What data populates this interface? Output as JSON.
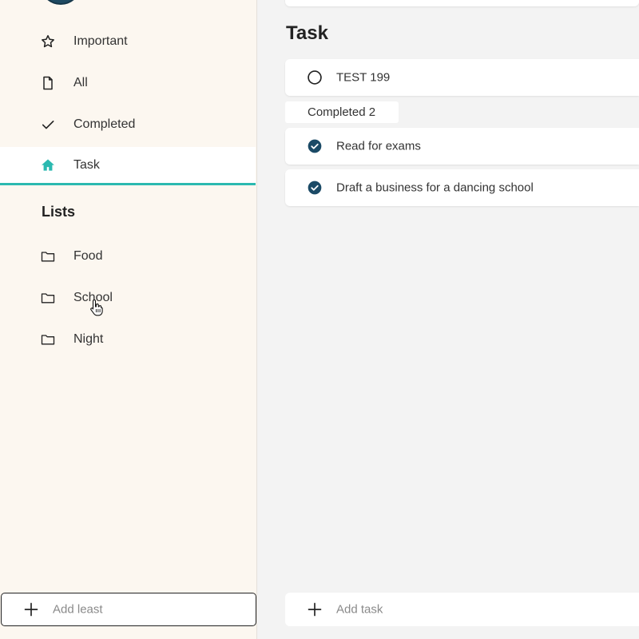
{
  "sidebar": {
    "nav": [
      {
        "label": "Important",
        "icon": "star-icon"
      },
      {
        "label": "All",
        "icon": "file-icon"
      },
      {
        "label": "Completed",
        "icon": "check-icon"
      },
      {
        "label": "Task",
        "icon": "home-icon",
        "active": true
      }
    ],
    "lists_heading": "Lists",
    "lists": [
      {
        "label": "Food",
        "icon": "folder-icon"
      },
      {
        "label": "School",
        "icon": "folder-icon"
      },
      {
        "label": "Night",
        "icon": "folder-icon"
      }
    ],
    "add_list_placeholder": "Add least"
  },
  "main": {
    "title": "Task",
    "tasks": [
      {
        "text": "TEST 199",
        "done": false
      }
    ],
    "completed_label": "Completed 2",
    "completed_tasks": [
      {
        "text": "Read for exams",
        "done": true
      },
      {
        "text": "Draft a business for a dancing school",
        "done": true
      }
    ],
    "add_task_placeholder": "Add task"
  },
  "colors": {
    "sidebar_bg": "#fcf7f0",
    "accent": "#2bb9b0",
    "check_fill": "#1b4a66",
    "main_bg": "#f3f3f3"
  }
}
